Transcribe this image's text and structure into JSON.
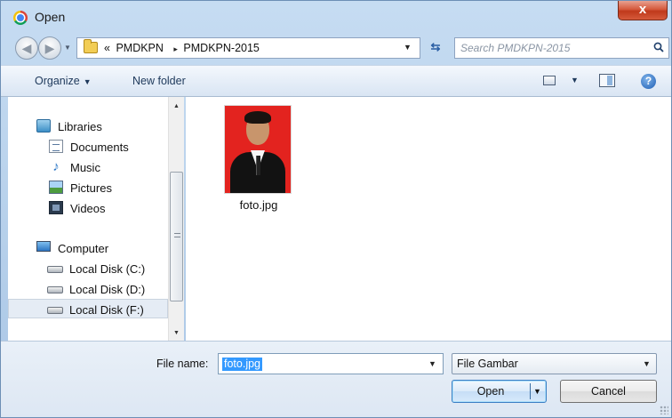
{
  "window": {
    "title": "Open",
    "close_glyph": "x"
  },
  "address": {
    "crumbs": [
      "PMDKPN",
      "PMDKPN-2015"
    ],
    "overflow_glyph": "«",
    "separator_glyph": "▸"
  },
  "search": {
    "placeholder": "Search PMDKPN-2015"
  },
  "toolbar": {
    "organize_label": "Organize",
    "new_folder_label": "New folder",
    "help_glyph": "?"
  },
  "navpane": {
    "libraries_label": "Libraries",
    "documents_label": "Documents",
    "music_label": "Music",
    "pictures_label": "Pictures",
    "videos_label": "Videos",
    "computer_label": "Computer",
    "disk_c_label": "Local Disk (C:)",
    "disk_d_label": "Local Disk (D:)",
    "disk_f_label": "Local Disk (F:)",
    "selected": "Local Disk (F:)"
  },
  "files": [
    {
      "name": "foto.jpg"
    }
  ],
  "bottom": {
    "file_name_label": "File name:",
    "file_name_value": "foto.jpg",
    "file_type_value": "File Gambar",
    "open_label": "Open",
    "cancel_label": "Cancel"
  },
  "colors": {
    "chrome": "#b5cfea",
    "selection": "#3399ff",
    "photo_background": "#e3231f"
  },
  "icons": [
    "chrome-icon",
    "back-arrow-icon",
    "forward-arrow-icon",
    "folder-icon",
    "refresh-icon",
    "search-icon",
    "views-icon",
    "preview-pane-icon",
    "help-icon",
    "libraries-icon",
    "document-icon",
    "music-icon",
    "pictures-icon",
    "videos-icon",
    "computer-icon",
    "disk-icon"
  ]
}
